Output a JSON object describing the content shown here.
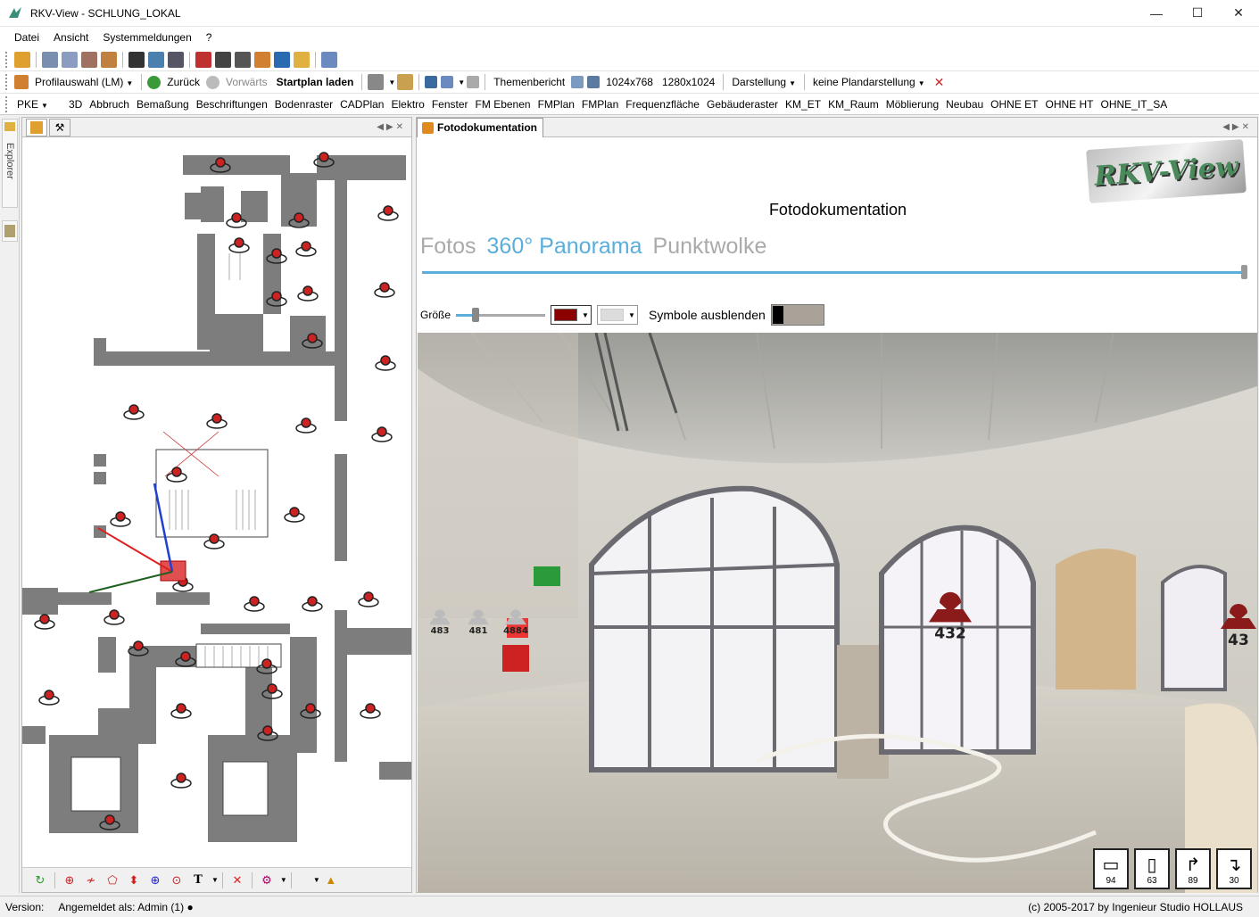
{
  "window": {
    "title": "RKV-View - SCHLUNG_LOKAL",
    "icon": "rkv-app-icon"
  },
  "menu": [
    "Datei",
    "Ansicht",
    "Systemmeldungen",
    "?"
  ],
  "toolbar2": {
    "profile": "Profilauswahl (LM)",
    "back": "Zurück",
    "forward": "Vorwärts",
    "startplan": "Startplan laden",
    "themenbericht": "Themenbericht",
    "res1": "1024x768",
    "res2": "1280x1024",
    "darstellung": "Darstellung",
    "plandarstellung": "keine Plandarstellung"
  },
  "layers": {
    "first": "PKE",
    "items": [
      "3D",
      "Abbruch",
      "Bemaßung",
      "Beschriftungen",
      "Bodenraster",
      "CADPlan",
      "Elektro",
      "Fenster",
      "FM Ebenen",
      "FMPlan",
      "FMPlan",
      "Frequenzfläche",
      "Gebäuderaster",
      "KM_ET",
      "KM_Raum",
      "Möblierung",
      "Neubau",
      "OHNE ET",
      "OHNE HT",
      "OHNE_IT_SA"
    ]
  },
  "sidebar": {
    "explorer_label": "Explorer"
  },
  "right_pane": {
    "tab_label": "Fotodokumentation",
    "logo_text": "RKV-View",
    "heading": "Fotodokumentation",
    "tabs": [
      {
        "label": "Fotos",
        "active": false
      },
      {
        "label": "360° Panorama",
        "active": true
      },
      {
        "label": "Punktwolke",
        "active": false
      }
    ],
    "size_label": "Größe",
    "size_value": 0.22,
    "symbol_color": "#8b0000",
    "bg_color": "#dcdcdc",
    "hide_symbols_label": "Symbole ausblenden",
    "hud": [
      {
        "icon": "floor-plan-icon",
        "value": "94"
      },
      {
        "icon": "room-icon",
        "value": "63"
      },
      {
        "icon": "axis-icon",
        "value": "89"
      },
      {
        "icon": "axis-down-icon",
        "value": "30"
      }
    ],
    "markers": [
      {
        "label": "483",
        "color": "#bbbbbb"
      },
      {
        "label": "481",
        "color": "#bbbbbb"
      },
      {
        "label": "4884",
        "color": "#bbbbbb"
      },
      {
        "label": "432",
        "color": "#8b1a1a"
      },
      {
        "label": "43",
        "color": "#8b1a1a"
      }
    ]
  },
  "status": {
    "version": "Version:",
    "user": "Angemeldet als: Admin (1)",
    "copyright": "(c) 2005-2017 by Ingenieur Studio HOLLAUS"
  }
}
